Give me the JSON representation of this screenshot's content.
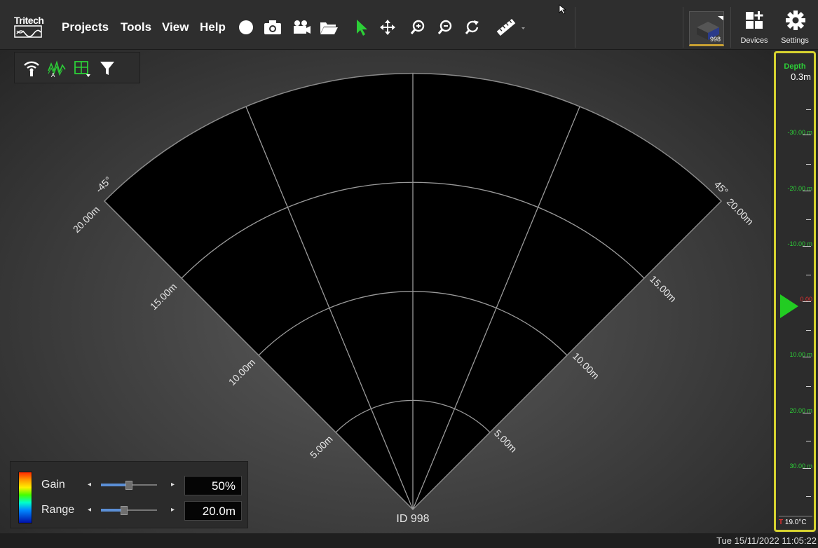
{
  "app": {
    "logo": "Tritech",
    "menus": [
      "Projects",
      "Tools",
      "View",
      "Help"
    ]
  },
  "toolbar": {
    "tools": [
      "record-icon",
      "camera-icon",
      "video-camera-icon",
      "folder-open-icon",
      "select-pointer-icon",
      "pan-move-icon",
      "zoom-in-icon",
      "zoom-out-icon",
      "reset-view-icon",
      "measure-ruler-icon"
    ],
    "device_id": "998",
    "devices_label": "Devices",
    "settings_label": "Settings"
  },
  "filter_bar": {
    "icons": [
      "signal-broadcast-icon",
      "auto-gain-icon",
      "grid-overlay-icon",
      "filter-icon"
    ]
  },
  "sonar": {
    "sector_left_label": "-45°",
    "sector_right_label": "45°",
    "range_labels": [
      "5.00m",
      "10.00m",
      "15.00m",
      "20.00m"
    ],
    "sonar_id": "ID 998"
  },
  "gain_panel": {
    "gain_label": "Gain",
    "gain_value": "50%",
    "gain_level": 0.5,
    "range_label": "Range",
    "range_value": "20.0m",
    "range_level": 0.4
  },
  "depth_gauge": {
    "title": "Depth",
    "value": "0.3m",
    "scale_labels": [
      "-30.00 m",
      "-20.00 m",
      "-10.00 m",
      "0.00",
      "10.00 m",
      "20.00 m",
      "30.00 m"
    ],
    "temperature_prefix": "T",
    "temperature": "19.0°C",
    "colors": {
      "frame": "#d6d230",
      "labels": "#2ccf37",
      "zero": "#e03030",
      "marker": "#22cc22"
    }
  },
  "status_bar": {
    "datetime": "Tue 15/11/2022 11:05:22"
  }
}
